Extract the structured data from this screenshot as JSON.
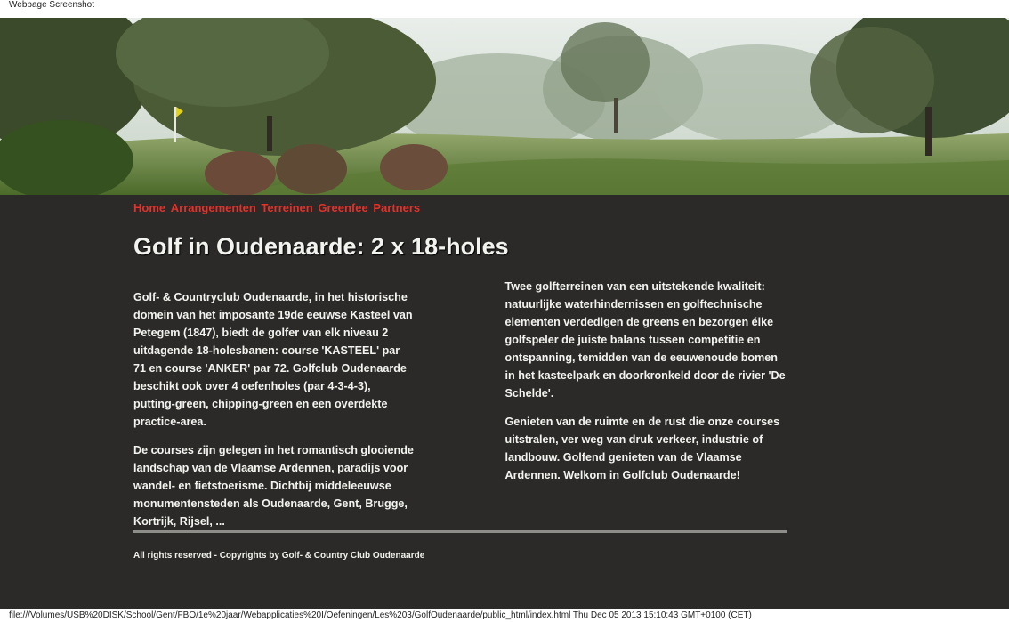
{
  "screenshot_label": "Webpage Screenshot",
  "nav": {
    "items": [
      "Home",
      "Arrangementen",
      "Terreinen",
      "Greenfee",
      "Partners"
    ]
  },
  "page_title": "Golf in Oudenaarde: 2 x 18-holes",
  "paragraphs": [
    "Golf- & Countryclub Oudenaarde, in het historische domein van het imposante 19de eeuwse Kasteel van Petegem (1847), biedt de golfer van elk niveau 2 uitdagende 18-holesbanen: course 'KASTEEL' par 71 en course 'ANKER' par 72. Golfclub Oudenaarde beschikt ook over 4 oefenholes (par 4-3-4-3), putting-green, chipping-green en een overdekte practice-area.",
    "De courses zijn gelegen in het romantisch glooiende landschap van de Vlaamse Ardennen, paradijs voor wandel- en fietstoerisme. Dichtbij middeleeuwse monumentensteden als Oudenaarde, Gent, Brugge, Kortrijk, Rijsel, ...",
    "Twee golfterreinen van een uitstekende kwaliteit: natuurlijke waterhindernissen en golftechnische elementen verdedigen de greens en bezorgen élke golfspeler de juiste balans tussen competitie en ontspanning, temidden van de eeuwenoude bomen in het kasteelpark en doorkronkeld door de rivier 'De Schelde'.",
    "Genieten van de ruimte en de rust die onze courses uitstralen, ver weg van druk verkeer, industrie of landbouw. Golfend genieten van de Vlaamse Ardennen. Welkom in Golfclub Oudenaarde!"
  ],
  "footer": "All rights reserved - Copyrights by Golf- & Country Club Oudenaarde",
  "status_bar": "file:///Volumes/USB%20DISK/School/Gent/FBO/1e%20jaar/Webapplicaties%20I/Oefeningen/Les%203/GolfOudenaarde/public_html/index.html Thu Dec 05 2013 15:10:43 GMT+0100 (CET)",
  "colors": {
    "background": "#2b2a28",
    "nav_link": "#e3312b",
    "text": "#f3f3f0",
    "divider": "#8d8d8a"
  }
}
